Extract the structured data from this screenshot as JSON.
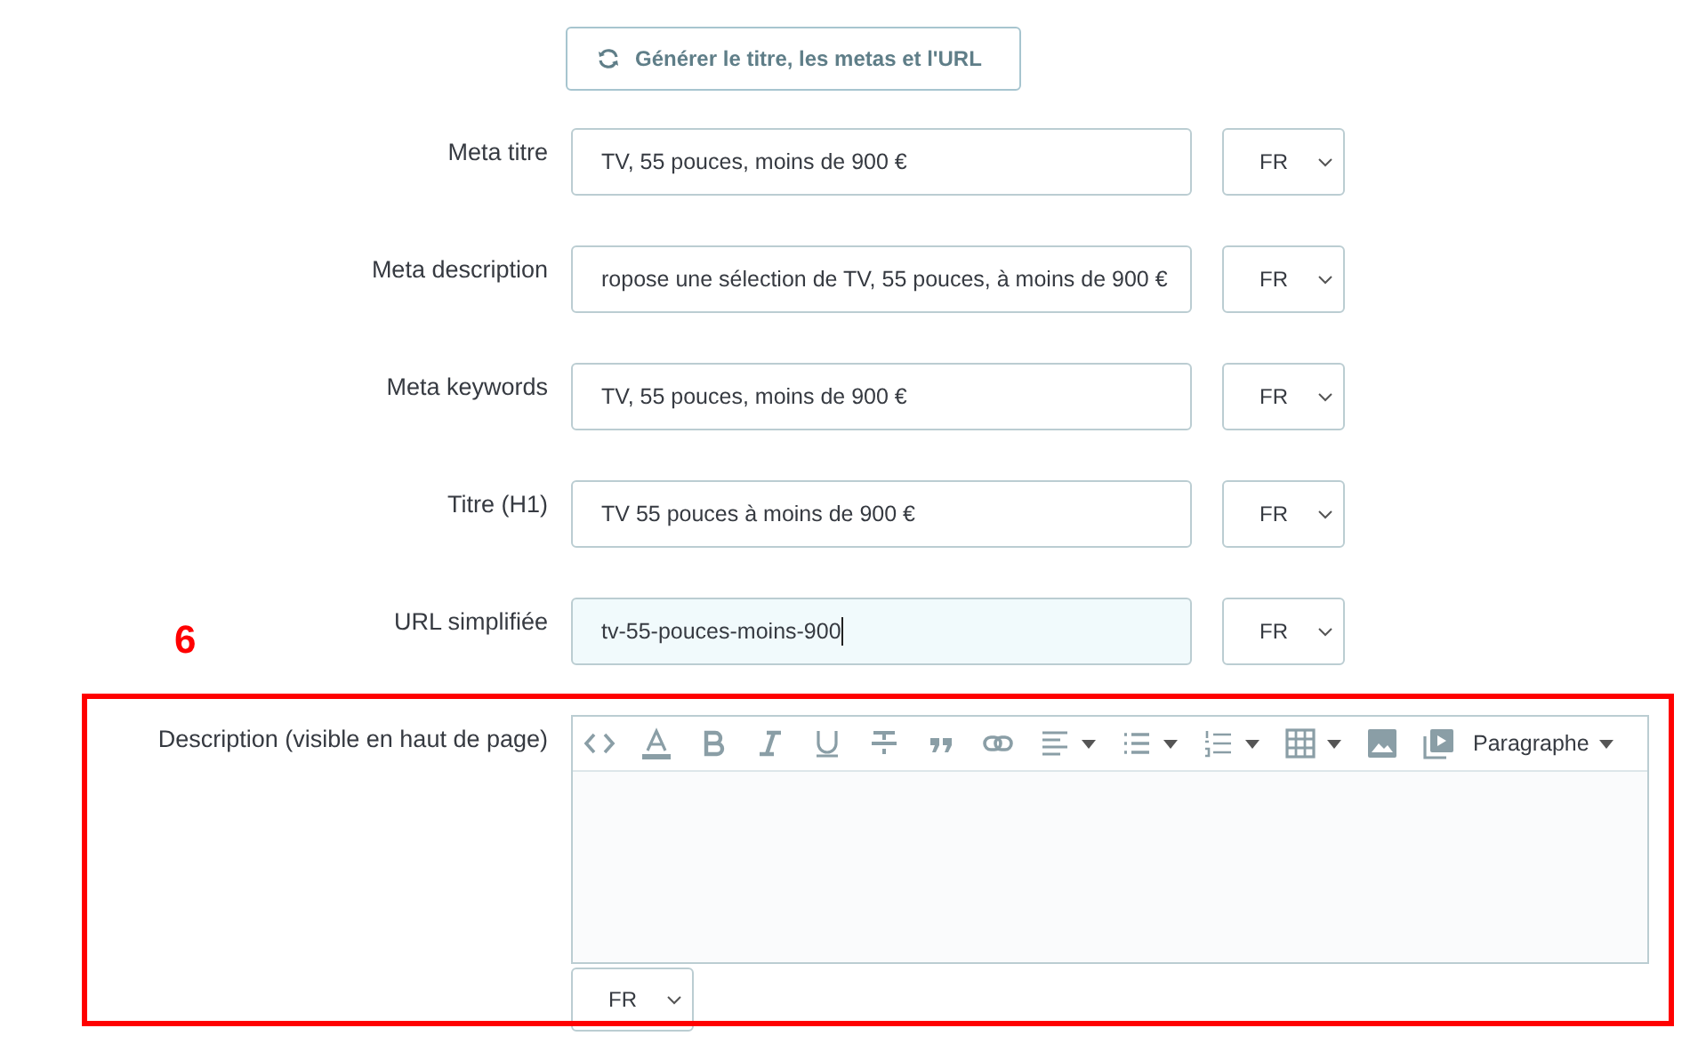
{
  "generate_button": {
    "label": "Générer le titre, les metas et l'URL"
  },
  "fields": [
    {
      "label": "Meta titre",
      "value": "TV, 55 pouces, moins de 900 €",
      "focused": false,
      "language": "FR"
    },
    {
      "label": "Meta description",
      "value": "ropose une sélection de TV, 55 pouces, à moins de 900 €",
      "focused": false,
      "language": "FR"
    },
    {
      "label": "Meta keywords",
      "value": "TV, 55 pouces, moins de 900 €",
      "focused": false,
      "language": "FR"
    },
    {
      "label": "Titre (H1)",
      "value": "TV 55 pouces à moins de 900 €",
      "focused": false,
      "language": "FR"
    },
    {
      "label": "URL simplifiée",
      "value": "tv-55-pouces-moins-900",
      "focused": true,
      "language": "FR"
    }
  ],
  "annotation": {
    "label": "6"
  },
  "description": {
    "label": "Description (visible en haut de page)",
    "language": "FR",
    "toolbar": [
      {
        "kind": "code",
        "dropdown": false
      },
      {
        "kind": "color",
        "dropdown": false
      },
      {
        "kind": "bold",
        "dropdown": false
      },
      {
        "kind": "italic",
        "dropdown": false
      },
      {
        "kind": "underline",
        "dropdown": false
      },
      {
        "kind": "strike",
        "dropdown": false
      },
      {
        "kind": "quote",
        "dropdown": false
      },
      {
        "kind": "link",
        "dropdown": false
      },
      {
        "kind": "align",
        "dropdown": true
      },
      {
        "kind": "bullets",
        "dropdown": true
      },
      {
        "kind": "numbers",
        "dropdown": true
      },
      {
        "kind": "table",
        "dropdown": true
      },
      {
        "kind": "image",
        "dropdown": false
      },
      {
        "kind": "video",
        "dropdown": false
      }
    ],
    "format": {
      "label": "Paragraphe"
    }
  }
}
